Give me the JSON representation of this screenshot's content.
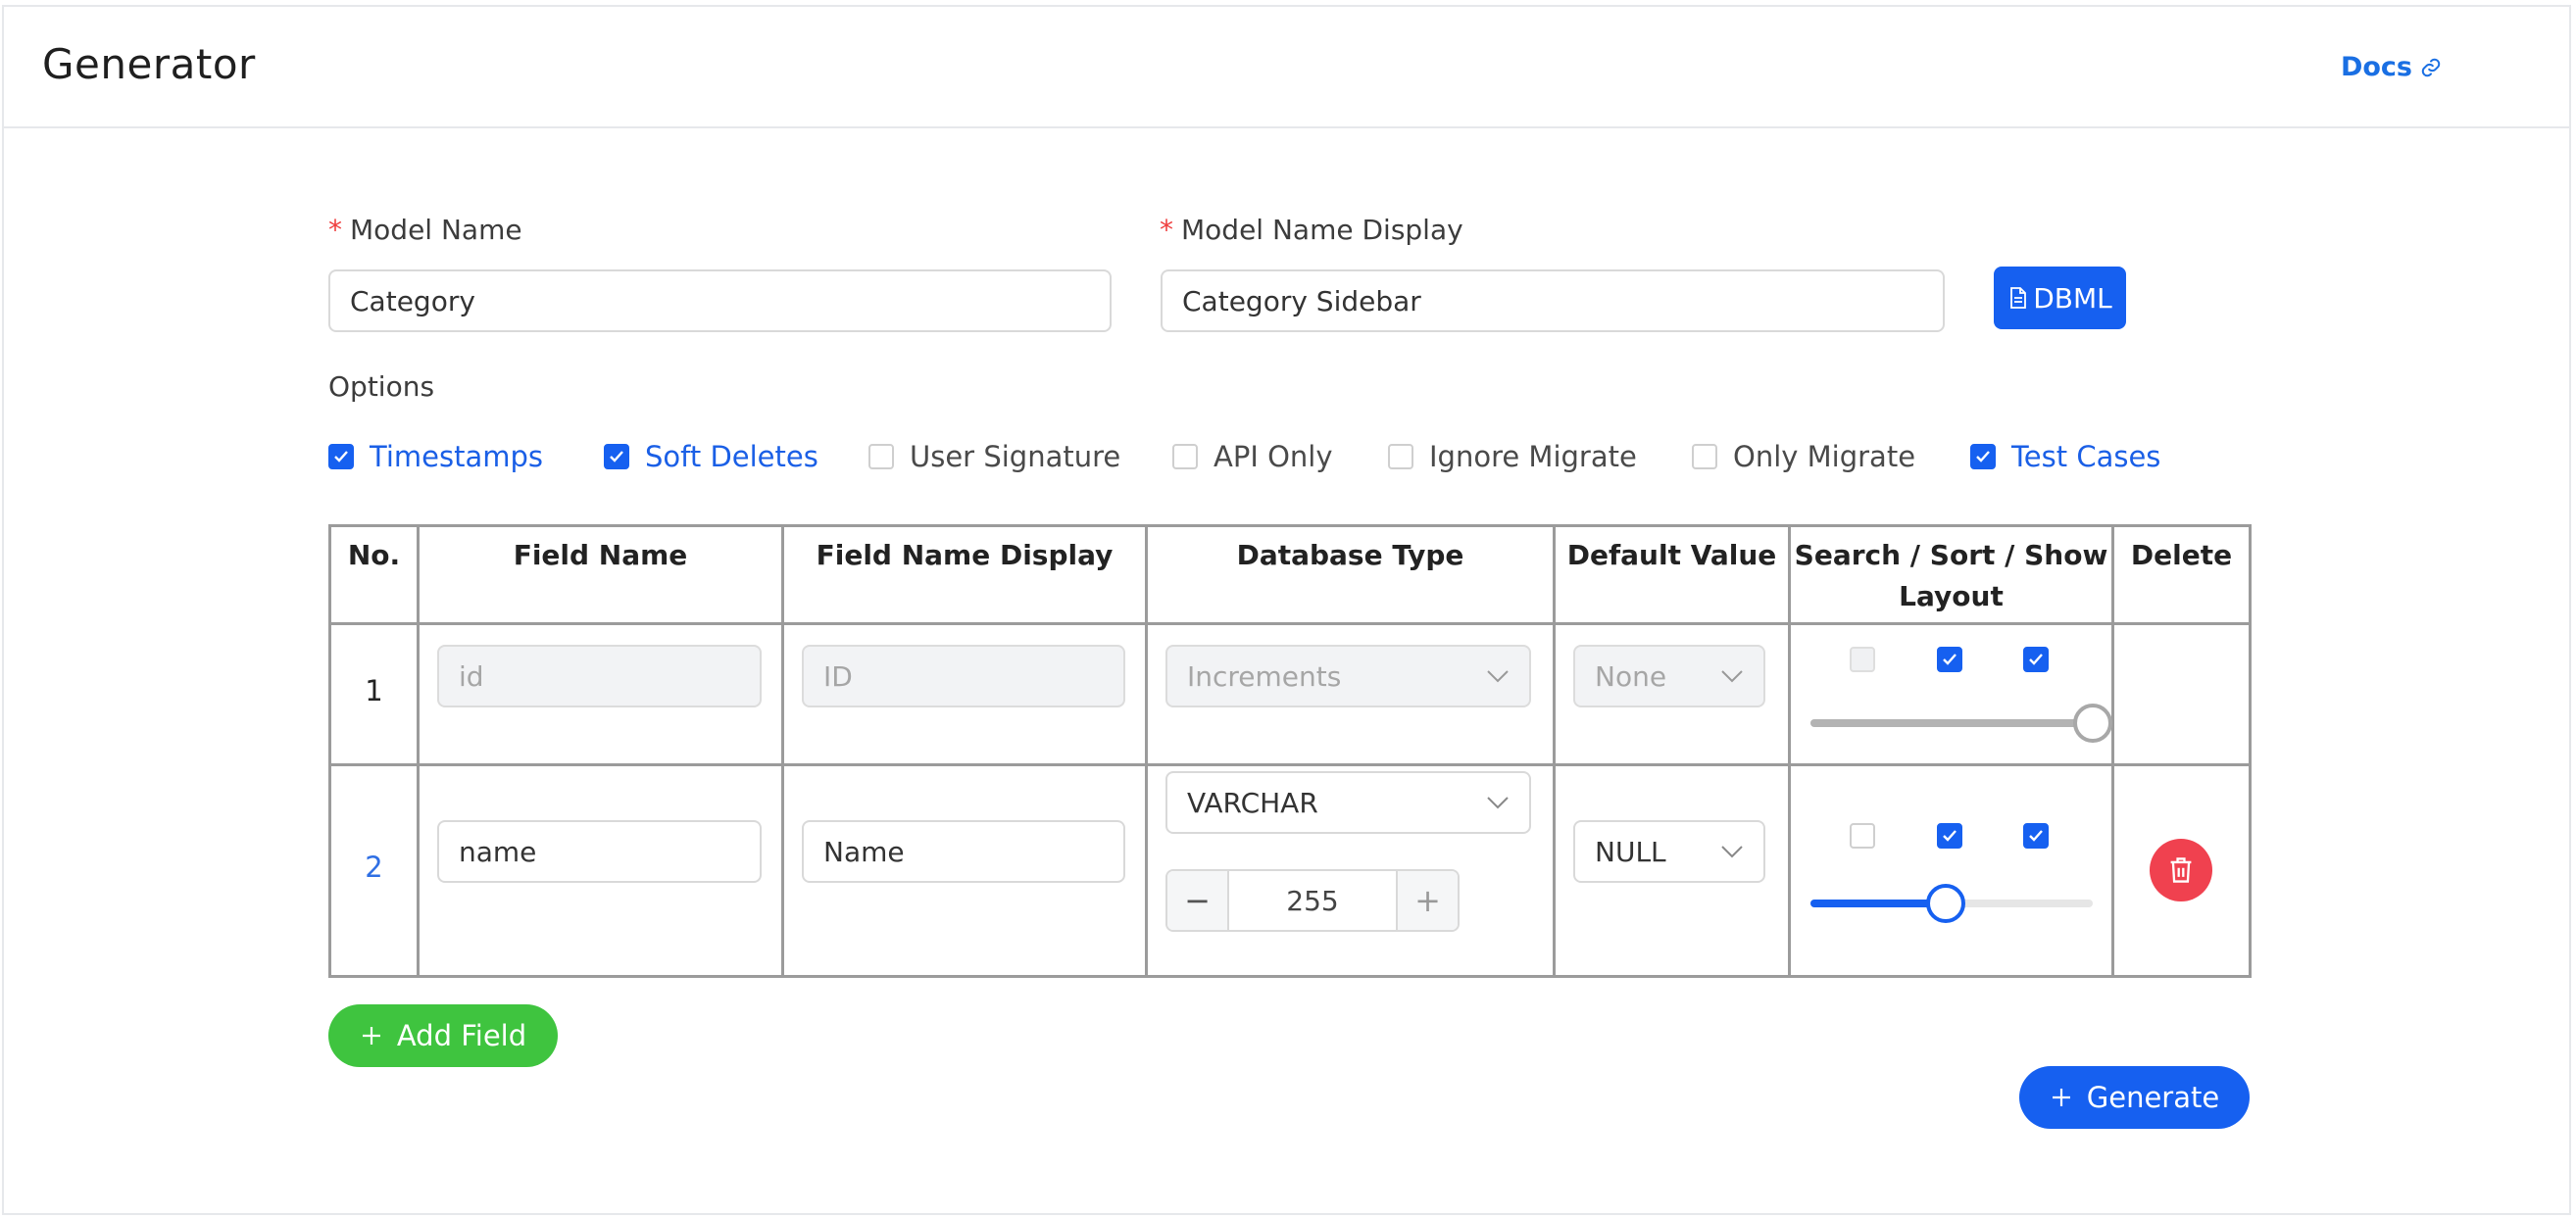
{
  "header": {
    "title": "Generator",
    "docs_label": "Docs"
  },
  "form": {
    "model_name_label": "Model Name",
    "model_name_value": "Category",
    "model_display_label": "Model Name Display",
    "model_display_value": "Category Sidebar",
    "dbml_label": "DBML"
  },
  "options": {
    "label": "Options",
    "items": [
      {
        "label": "Timestamps",
        "checked": true
      },
      {
        "label": "Soft Deletes",
        "checked": true
      },
      {
        "label": "User Signature",
        "checked": false
      },
      {
        "label": "API Only",
        "checked": false
      },
      {
        "label": "Ignore Migrate",
        "checked": false
      },
      {
        "label": "Only Migrate",
        "checked": false
      },
      {
        "label": "Test Cases",
        "checked": true
      }
    ]
  },
  "table": {
    "headers": [
      "No.",
      "Field Name",
      "Field Name Display",
      "Database Type",
      "Default Value",
      "Search / Sort / Show",
      "Layout",
      "Delete"
    ],
    "rows": [
      {
        "no": "1",
        "field_name": "id",
        "field_display": "ID",
        "db_type": "Increments",
        "default_value": "None",
        "search": false,
        "sort": true,
        "show": true,
        "layout_fraction": 1.0,
        "disabled": true
      },
      {
        "no": "2",
        "field_name": "name",
        "field_display": "Name",
        "db_type": "VARCHAR",
        "length": "255",
        "default_value": "NULL",
        "search": false,
        "sort": true,
        "show": true,
        "layout_fraction": 0.48,
        "disabled": false
      }
    ]
  },
  "actions": {
    "add_field_label": "Add Field",
    "generate_label": "Generate"
  },
  "colors": {
    "primary": "#1660f0",
    "success": "#3fc43f",
    "danger": "#f0414f",
    "required": "#ef3e3e",
    "link": "#1a6fe3"
  }
}
